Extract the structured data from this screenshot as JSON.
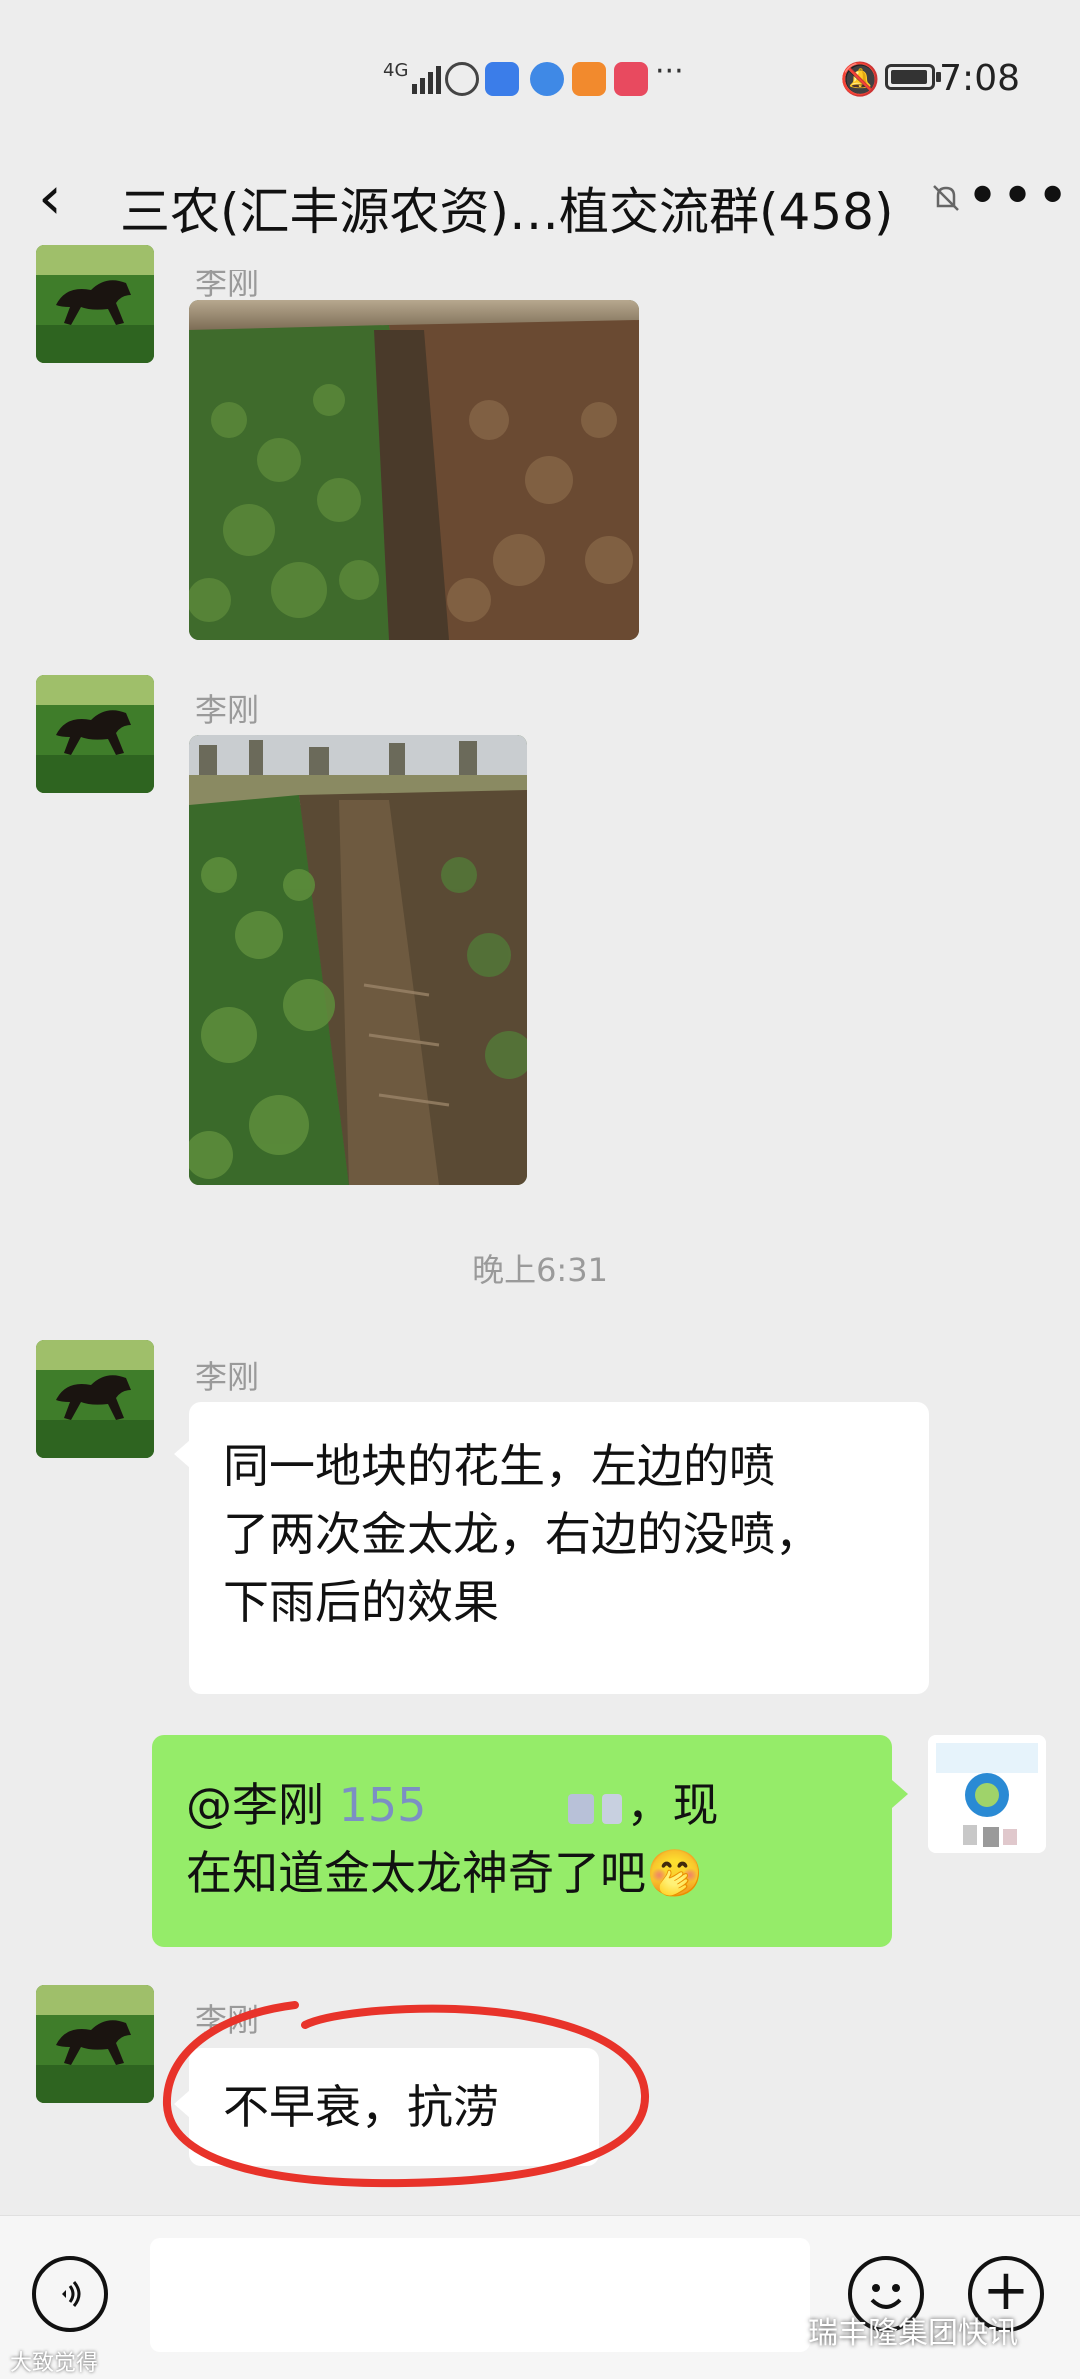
{
  "status_bar": {
    "signal": "4G",
    "time": "7:08"
  },
  "header": {
    "title": "三农(汇丰源农资)…植交流群(458)"
  },
  "messages": [
    {
      "sender": "李刚",
      "kind": "image",
      "alt": "花生田照片1"
    },
    {
      "sender": "李刚",
      "kind": "image",
      "alt": "花生田照片2"
    },
    {
      "timestamp": "晚上6:31"
    },
    {
      "sender": "李刚",
      "kind": "text",
      "text_lines": [
        "同一地块的花生，左边的喷",
        "了两次金太龙，右边的没喷，",
        "下雨后的效果"
      ]
    },
    {
      "kind": "text",
      "outgoing": true,
      "mention": "@李刚",
      "phone": "155",
      "line1_end": "，现",
      "line2": "在知道金太龙神奇了吧🤭"
    },
    {
      "sender": "李刚",
      "kind": "text",
      "text": "不早衰，抗涝"
    }
  ],
  "colors": {
    "background": "#ededed",
    "outgoing_bubble": "#95ec69",
    "incoming_bubble": "#ffffff",
    "annotation_red": "#e8332a"
  },
  "icons": {
    "voice": "voice-icon",
    "emoji": "emoji-icon",
    "plus": "plus-icon"
  },
  "watermarks": {
    "left": "大致觉得",
    "right": "瑞丰隆集团快讯"
  }
}
